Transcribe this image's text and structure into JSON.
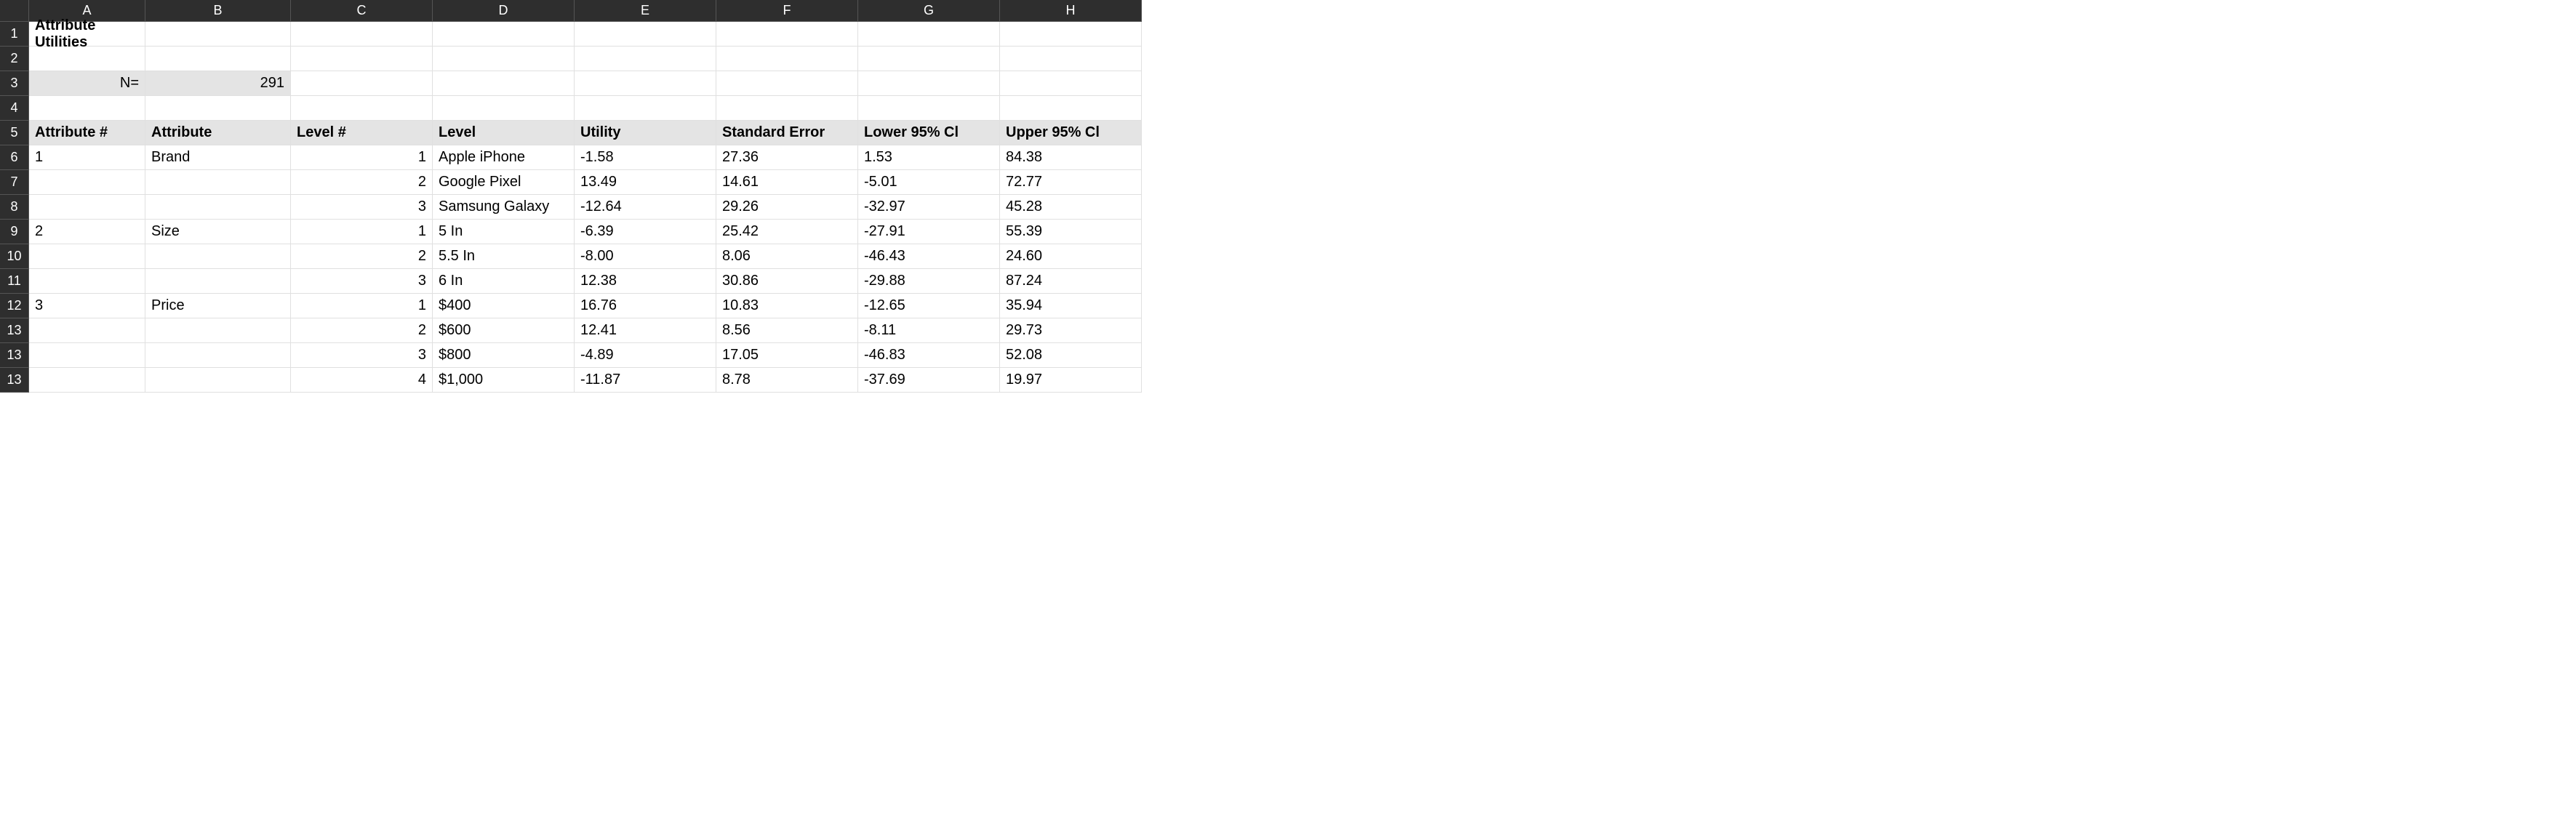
{
  "columns": [
    "A",
    "B",
    "C",
    "D",
    "E",
    "F",
    "G",
    "H"
  ],
  "rowNumbers": [
    "1",
    "2",
    "3",
    "4",
    "5",
    "6",
    "7",
    "8",
    "9",
    "10",
    "11",
    "12",
    "13",
    "13",
    "13",
    "13"
  ],
  "title": "Attribute Utilities",
  "n": {
    "label": "N=",
    "value": "291"
  },
  "headers": {
    "attrNum": "Attribute #",
    "attr": "Attribute",
    "levelNum": "Level #",
    "level": "Level",
    "utility": "Utility",
    "stdErr": "Standard Error",
    "lowCI": "Lower 95% Cl",
    "upCI": "Upper 95% Cl"
  },
  "rows": [
    {
      "attrNum": "1",
      "attr": "Brand",
      "levelNum": "1",
      "level": "Apple iPhone",
      "utility": "-1.58",
      "stdErr": "27.36",
      "lowCI": "1.53",
      "upCI": "84.38"
    },
    {
      "attrNum": "",
      "attr": "",
      "levelNum": "2",
      "level": "Google Pixel",
      "utility": "13.49",
      "stdErr": "14.61",
      "lowCI": "-5.01",
      "upCI": "72.77"
    },
    {
      "attrNum": "",
      "attr": "",
      "levelNum": "3",
      "level": "Samsung Galaxy",
      "utility": "-12.64",
      "stdErr": "29.26",
      "lowCI": "-32.97",
      "upCI": "45.28"
    },
    {
      "attrNum": "2",
      "attr": "Size",
      "levelNum": "1",
      "level": "5 In",
      "utility": "-6.39",
      "stdErr": "25.42",
      "lowCI": "-27.91",
      "upCI": "55.39"
    },
    {
      "attrNum": "",
      "attr": "",
      "levelNum": "2",
      "level": "5.5 In",
      "utility": "-8.00",
      "stdErr": "8.06",
      "lowCI": "-46.43",
      "upCI": "24.60"
    },
    {
      "attrNum": "",
      "attr": "",
      "levelNum": "3",
      "level": "6 In",
      "utility": "12.38",
      "stdErr": "30.86",
      "lowCI": "-29.88",
      "upCI": "87.24"
    },
    {
      "attrNum": "3",
      "attr": "Price",
      "levelNum": "1",
      "level": "$400",
      "utility": "16.76",
      "stdErr": "10.83",
      "lowCI": "-12.65",
      "upCI": "35.94"
    },
    {
      "attrNum": "",
      "attr": "",
      "levelNum": "2",
      "level": "$600",
      "utility": "12.41",
      "stdErr": "8.56",
      "lowCI": "-8.11",
      "upCI": "29.73"
    },
    {
      "attrNum": "",
      "attr": "",
      "levelNum": "3",
      "level": "$800",
      "utility": "-4.89",
      "stdErr": "17.05",
      "lowCI": "-46.83",
      "upCI": "52.08"
    },
    {
      "attrNum": "",
      "attr": "",
      "levelNum": "4",
      "level": "$1,000",
      "utility": "-11.87",
      "stdErr": "8.78",
      "lowCI": "-37.69",
      "upCI": "19.97"
    }
  ]
}
